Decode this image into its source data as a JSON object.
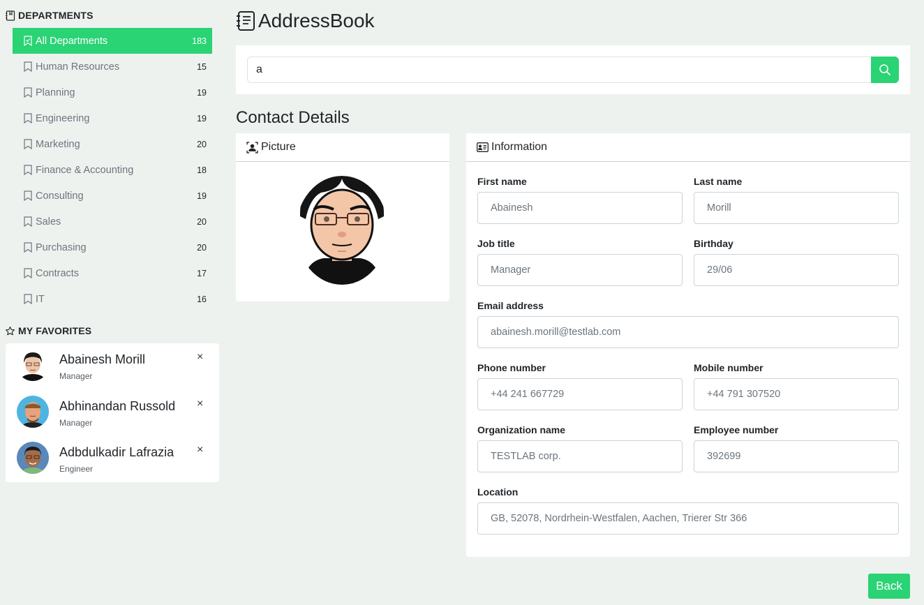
{
  "sidebar": {
    "departments_title": "DEPARTMENTS",
    "departments": [
      {
        "label": "All Departments",
        "count": "183",
        "active": true
      },
      {
        "label": "Human Resources",
        "count": "15"
      },
      {
        "label": "Planning",
        "count": "19"
      },
      {
        "label": "Engineering",
        "count": "19"
      },
      {
        "label": "Marketing",
        "count": "20"
      },
      {
        "label": "Finance & Accounting",
        "count": "18"
      },
      {
        "label": "Consulting",
        "count": "19"
      },
      {
        "label": "Sales",
        "count": "20"
      },
      {
        "label": "Purchasing",
        "count": "20"
      },
      {
        "label": "Contracts",
        "count": "17"
      },
      {
        "label": "IT",
        "count": "16"
      }
    ],
    "favorites_title": "MY FAVORITES",
    "favorites": [
      {
        "name": "Abainesh Morill",
        "role": "Manager"
      },
      {
        "name": "Abhinandan Russold",
        "role": "Manager"
      },
      {
        "name": "Adbdulkadir Lafrazia",
        "role": "Engineer"
      }
    ],
    "remove_glyph": "×"
  },
  "header": {
    "title": "AddressBook",
    "icon": "address-book-icon"
  },
  "search": {
    "value": "a",
    "button_icon": "search-icon"
  },
  "contact": {
    "section_title": "Contact Details",
    "picture_title": "Picture",
    "info_title": "Information",
    "fields": {
      "first_name": {
        "label": "First name",
        "value": "Abainesh"
      },
      "last_name": {
        "label": "Last name",
        "value": "Morill"
      },
      "job_title": {
        "label": "Job title",
        "value": "Manager"
      },
      "birthday": {
        "label": "Birthday",
        "value": "29/06"
      },
      "email": {
        "label": "Email address",
        "value": "abainesh.morill@testlab.com"
      },
      "phone": {
        "label": "Phone number",
        "value": "+44 241 667729"
      },
      "mobile": {
        "label": "Mobile number",
        "value": "+44 791 307520"
      },
      "organization": {
        "label": "Organization name",
        "value": "TESTLAB corp."
      },
      "employee_number": {
        "label": "Employee number",
        "value": "392699"
      },
      "location": {
        "label": "Location",
        "value": "GB, 52078, Nordrhein-Westfalen, Aachen, Trierer Str 366"
      }
    }
  },
  "footer": {
    "back_label": "Back"
  },
  "colors": {
    "accent": "#2ad374",
    "background": "#eef2ef"
  }
}
